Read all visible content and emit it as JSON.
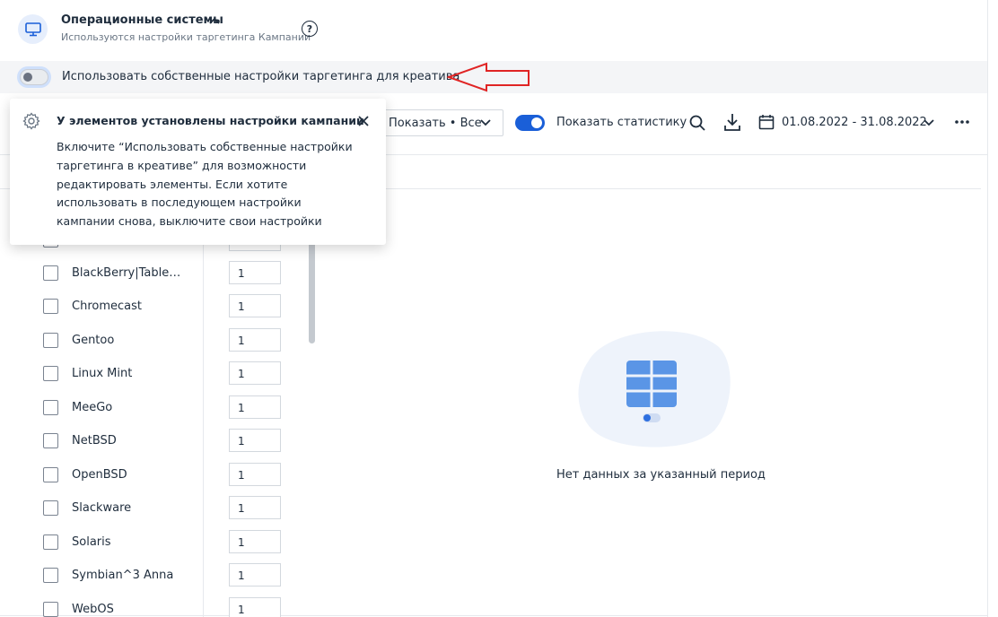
{
  "header": {
    "title": "Операционные системы",
    "subtitle": "Используются настройки таргетинга Кампании",
    "help": "?"
  },
  "own_settings": {
    "label": "Использовать собственные настройки таргетинга для креатива",
    "enabled": false
  },
  "toolbar": {
    "show_select": "Показать • Все",
    "show_stats_label": "Показать статистику",
    "show_stats_enabled": true,
    "date_range": "01.08.2022 - 31.08.2022"
  },
  "popover": {
    "title": "У элементов установлены настройки кампании",
    "lines": [
      "Включите “Использовать собственные настройки",
      "таргетинга в креативе” для возможности",
      "редактировать элементы. Если хотите",
      "использовать в последующем настройки",
      "кампании снова, выключите свои настройки"
    ]
  },
  "os_list": [
    {
      "name": "",
      "value": ""
    },
    {
      "name": "BlackBerry|Table…",
      "value": "1"
    },
    {
      "name": "Chromecast",
      "value": "1"
    },
    {
      "name": "Gentoo",
      "value": "1"
    },
    {
      "name": "Linux Mint",
      "value": "1"
    },
    {
      "name": "MeeGo",
      "value": "1"
    },
    {
      "name": "NetBSD",
      "value": "1"
    },
    {
      "name": "OpenBSD",
      "value": "1"
    },
    {
      "name": "Slackware",
      "value": "1"
    },
    {
      "name": "Solaris",
      "value": "1"
    },
    {
      "name": "Symbian^3 Anna",
      "value": "1"
    },
    {
      "name": "WebOS",
      "value": "1"
    }
  ],
  "empty_state": {
    "text": "Нет данных за указанный период"
  },
  "colors": {
    "accent": "#1a5fd8",
    "annotation_arrow": "#e02424"
  }
}
